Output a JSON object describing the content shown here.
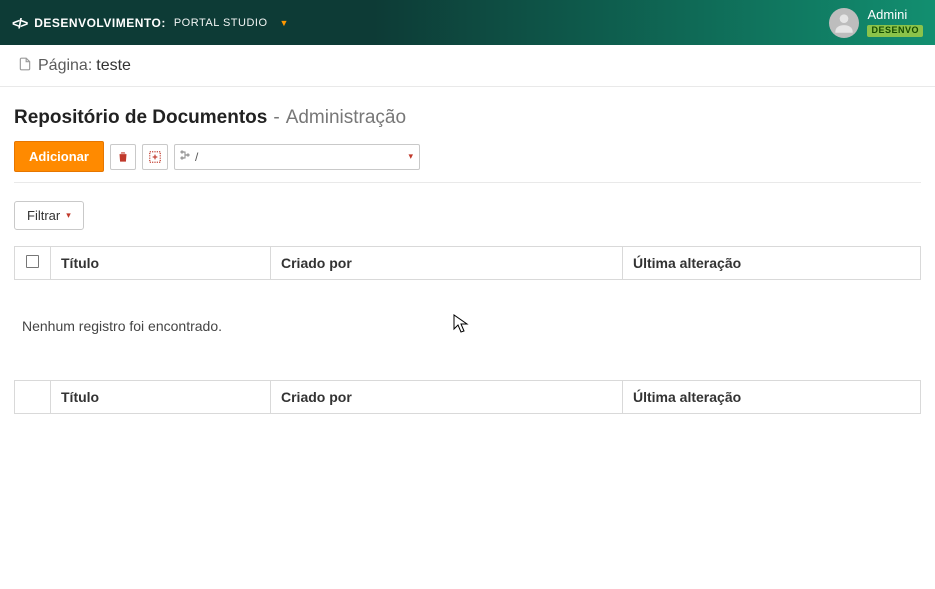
{
  "header": {
    "env_label": "DESENVOLVIMENTO:",
    "portal_label": "PORTAL STUDIO",
    "user_name": "Admini",
    "user_env_badge": "DESENVO"
  },
  "page_bar": {
    "prefix": "Página:",
    "name": "teste"
  },
  "title": {
    "main": "Repositório de Documentos",
    "separator": "-",
    "sub": "Administração"
  },
  "toolbar": {
    "add_label": "Adicionar",
    "select_value": "/"
  },
  "filter": {
    "label": "Filtrar"
  },
  "table": {
    "columns": {
      "title": "Título",
      "created_by": "Criado por",
      "last_modified": "Última alteração"
    },
    "empty_message": "Nenhum registro foi encontrado."
  }
}
